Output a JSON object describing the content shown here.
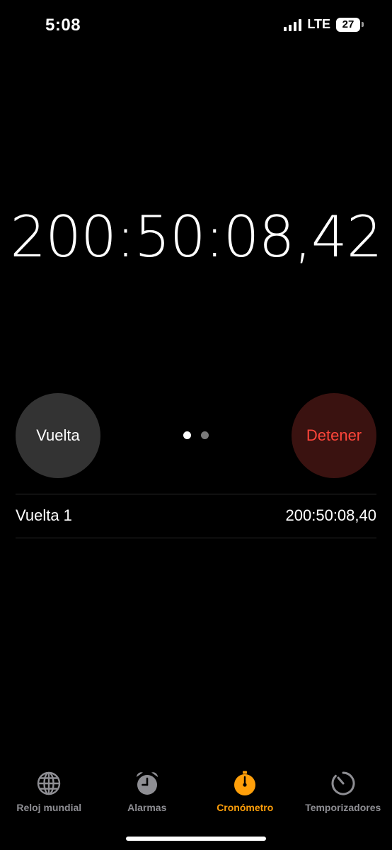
{
  "status_bar": {
    "time": "5:08",
    "network": "LTE",
    "battery": "27"
  },
  "stopwatch": {
    "main_time": "200:50:08,42"
  },
  "controls": {
    "lap_label": "Vuelta",
    "stop_label": "Detener",
    "page_count": 2,
    "active_page": 1
  },
  "laps": [
    {
      "label": "Vuelta 1",
      "time": "200:50:08,40"
    }
  ],
  "tabs": [
    {
      "label": "Reloj mundial",
      "icon": "globe-icon",
      "active": false
    },
    {
      "label": "Alarmas",
      "icon": "alarm-clock-icon",
      "active": false
    },
    {
      "label": "Cronómetro",
      "icon": "stopwatch-icon",
      "active": true
    },
    {
      "label": "Temporizadores",
      "icon": "timer-icon",
      "active": false
    }
  ],
  "colors": {
    "background": "#000000",
    "accent": "#ff9f0a",
    "stop_text": "#ff453a",
    "stop_button": "#3a1210",
    "lap_button": "#333333",
    "inactive_tab": "#8e8e93"
  }
}
